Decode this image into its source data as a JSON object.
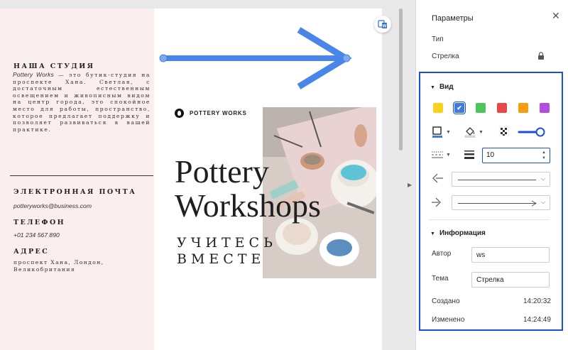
{
  "document": {
    "studio_heading": "НАША СТУДИЯ",
    "studio_brand": "Pottery Works",
    "studio_text": " — это бутик-студия на проспекте Хана. Светлая, с достаточным естественным освещением и живописным видом на центр города, это спокойное место для работы, пространство, которое предлагает поддержку и позволяет развиваться в вашей практике.",
    "email_heading": "ЭЛЕКТРОННАЯ ПОЧТА",
    "email_value": "potteryworks@business.com",
    "phone_heading": "ТЕЛЕФОН",
    "phone_value": "+01 234 567 890",
    "address_heading": "АДРЕС",
    "address_value": "проспект Хана, Лондон, Великобритания",
    "brand_name": "POTTERY WORKS",
    "title_line1": "Pottery",
    "title_line2": "Workshops",
    "subtitle_line1": "УЧИТЕСЬ",
    "subtitle_line2": "ВМЕСТЕ",
    "arrow_color": "#4a86e8"
  },
  "panel": {
    "title": "Параметры",
    "type_label": "Тип",
    "type_value": "Стрелка",
    "view_heading": "Вид",
    "swatches": [
      "#f7d31f",
      "#3d7be0",
      "#4cc65a",
      "#e94848",
      "#f59c12",
      "#b14ee0"
    ],
    "selected_swatch": 1,
    "stroke_width": "10",
    "info_heading": "Информация",
    "author_label": "Автор",
    "author_value": "ws",
    "subject_label": "Тема",
    "subject_value": "Стрелка",
    "created_label": "Создано",
    "created_value": "14:20:32",
    "modified_label": "Изменено",
    "modified_value": "14:24:49",
    "accent": "#1a4fd8"
  }
}
